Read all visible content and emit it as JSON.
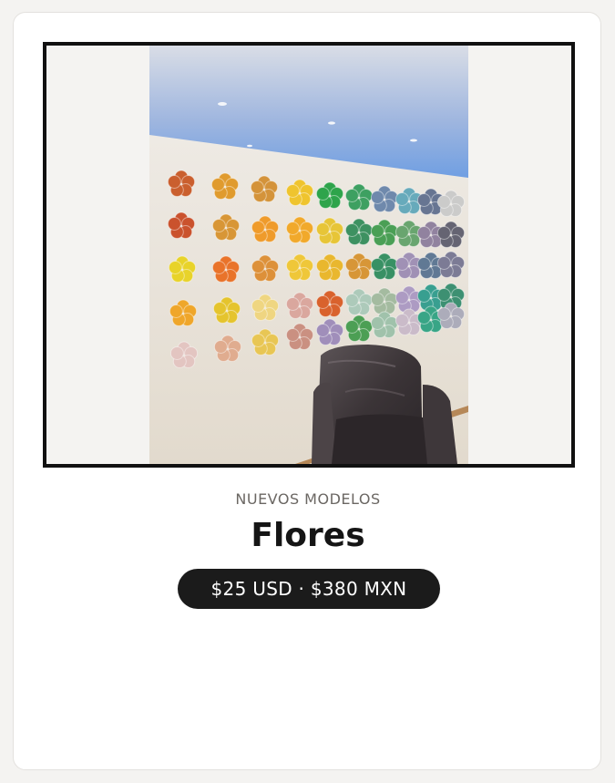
{
  "product": {
    "category": "NUEVOS MODELOS",
    "title": "Flores",
    "price": "$25 USD · $380 MXN",
    "image_alt": "Wall of colorful glass flowers with velvet armchair"
  },
  "colors": {
    "card_bg": "#ffffff",
    "page_bg": "#f4f3f1",
    "frame_border": "#111111",
    "pill_bg": "#1b1b1b",
    "pill_text": "#ffffff",
    "category_text": "#6b6763",
    "title_text": "#151515"
  }
}
